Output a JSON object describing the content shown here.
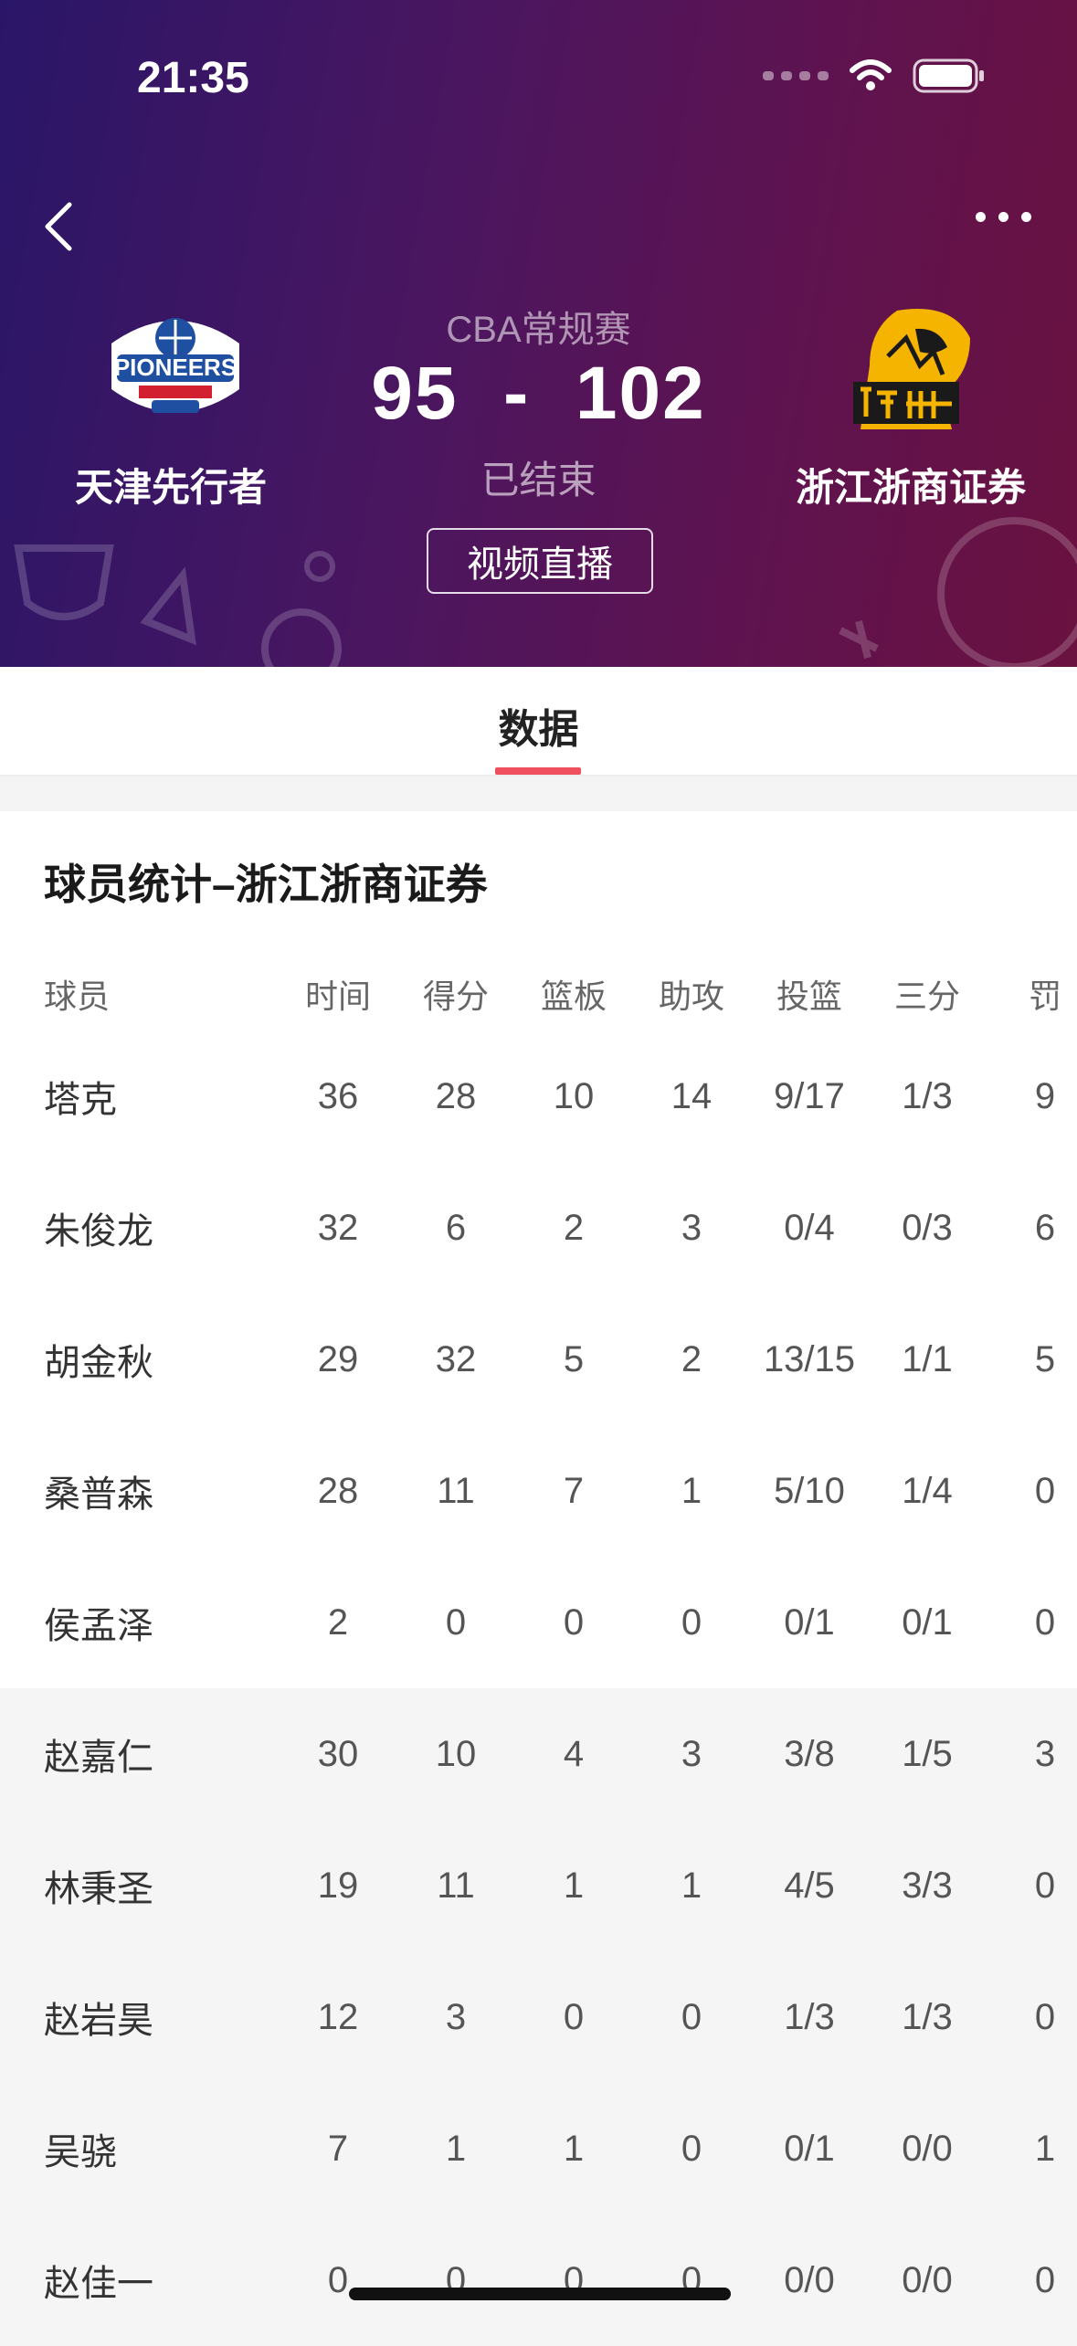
{
  "status_bar": {
    "time": "21:35"
  },
  "match": {
    "league": "CBA常规赛",
    "score": "95  -  102",
    "state": "已结束",
    "video_button": "视频直播",
    "home_team": {
      "name": "天津先行者",
      "logo_icon": "tianjin-pioneers-logo-icon"
    },
    "away_team": {
      "name": "浙江浙商证券",
      "logo_icon": "zhejiang-lions-logo-icon"
    }
  },
  "tabs": [
    {
      "label": "数据",
      "active": true
    }
  ],
  "stats": {
    "title": "球员统计–浙江浙商证券",
    "columns": [
      "球员",
      "时间",
      "得分",
      "篮板",
      "助攻",
      "投篮",
      "三分",
      "罚"
    ],
    "starters": [
      {
        "name": "塔克",
        "cols": [
          "36",
          "28",
          "10",
          "14",
          "9/17",
          "1/3",
          "9"
        ]
      },
      {
        "name": "朱俊龙",
        "cols": [
          "32",
          "6",
          "2",
          "3",
          "0/4",
          "0/3",
          "6"
        ]
      },
      {
        "name": "胡金秋",
        "cols": [
          "29",
          "32",
          "5",
          "2",
          "13/15",
          "1/1",
          "5"
        ]
      },
      {
        "name": "桑普森",
        "cols": [
          "28",
          "11",
          "7",
          "1",
          "5/10",
          "1/4",
          "0"
        ]
      },
      {
        "name": "侯孟泽",
        "cols": [
          "2",
          "0",
          "0",
          "0",
          "0/1",
          "0/1",
          "0"
        ]
      }
    ],
    "bench": [
      {
        "name": "赵嘉仁",
        "cols": [
          "30",
          "10",
          "4",
          "3",
          "3/8",
          "1/5",
          "3"
        ]
      },
      {
        "name": "林秉圣",
        "cols": [
          "19",
          "11",
          "1",
          "1",
          "4/5",
          "3/3",
          "0"
        ]
      },
      {
        "name": "赵岩昊",
        "cols": [
          "12",
          "3",
          "0",
          "0",
          "1/3",
          "1/3",
          "0"
        ]
      },
      {
        "name": "吴骁",
        "cols": [
          "7",
          "1",
          "1",
          "0",
          "0/1",
          "0/0",
          "1"
        ]
      },
      {
        "name": "赵佳一",
        "cols": [
          "0",
          "0",
          "0",
          "0",
          "0/0",
          "0/0",
          "0"
        ]
      }
    ]
  },
  "colors": {
    "accent": "#f0505e",
    "header_start": "#2a1668",
    "header_end": "#6a1240"
  }
}
